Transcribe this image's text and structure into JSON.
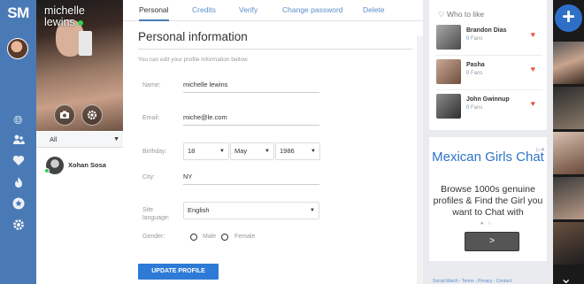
{
  "app": {
    "logo": "SM"
  },
  "profile": {
    "first_name": "michelle",
    "last_name": "lewins",
    "filter_value": "All"
  },
  "contacts": [
    {
      "name": "Xohan Sosa"
    }
  ],
  "tabs": [
    {
      "label": "Personal",
      "active": true
    },
    {
      "label": "Credits",
      "active": false
    },
    {
      "label": "Verify",
      "active": false
    },
    {
      "label": "Change password",
      "active": false
    },
    {
      "label": "Delete",
      "active": false
    }
  ],
  "form": {
    "title": "Personal information",
    "subtitle": "You can edit your profile information bellow",
    "name_label": "Name:",
    "name_value": "michelle lewins",
    "email_label": "Email:",
    "email_value": "miche@le.com",
    "birthday_label": "Birthday:",
    "birthday_day": "18",
    "birthday_month": "May",
    "birthday_year": "1986",
    "city_label": "City:",
    "city_value": "NY",
    "language_label": "Site language:",
    "language_value": "English",
    "gender_label": "Gender:",
    "gender_male": "Male",
    "gender_female": "Female",
    "update_button": "UPDATE PROFILE"
  },
  "who_to_like": {
    "title": "Who to like",
    "people": [
      {
        "name": "Brandon Dias",
        "fans_count": "0",
        "fans_label": "Fans"
      },
      {
        "name": "Pasha",
        "fans_count": "0",
        "fans_label": "Fans"
      },
      {
        "name": "John Gwinnup",
        "fans_count": "0",
        "fans_label": "Fans"
      }
    ]
  },
  "ad": {
    "title": "Mexican Girls Chat",
    "body": "Browse 1000s genuine profiles & Find the Girl you want to Chat with",
    "next_symbol": ">"
  },
  "footer": {
    "links": "Social Match - Terms - Privacy - Contact"
  },
  "colors": {
    "rail": "#4a7ab6",
    "accent": "#2d7bd6",
    "heart": "#e9573f",
    "online": "#36d14b"
  }
}
